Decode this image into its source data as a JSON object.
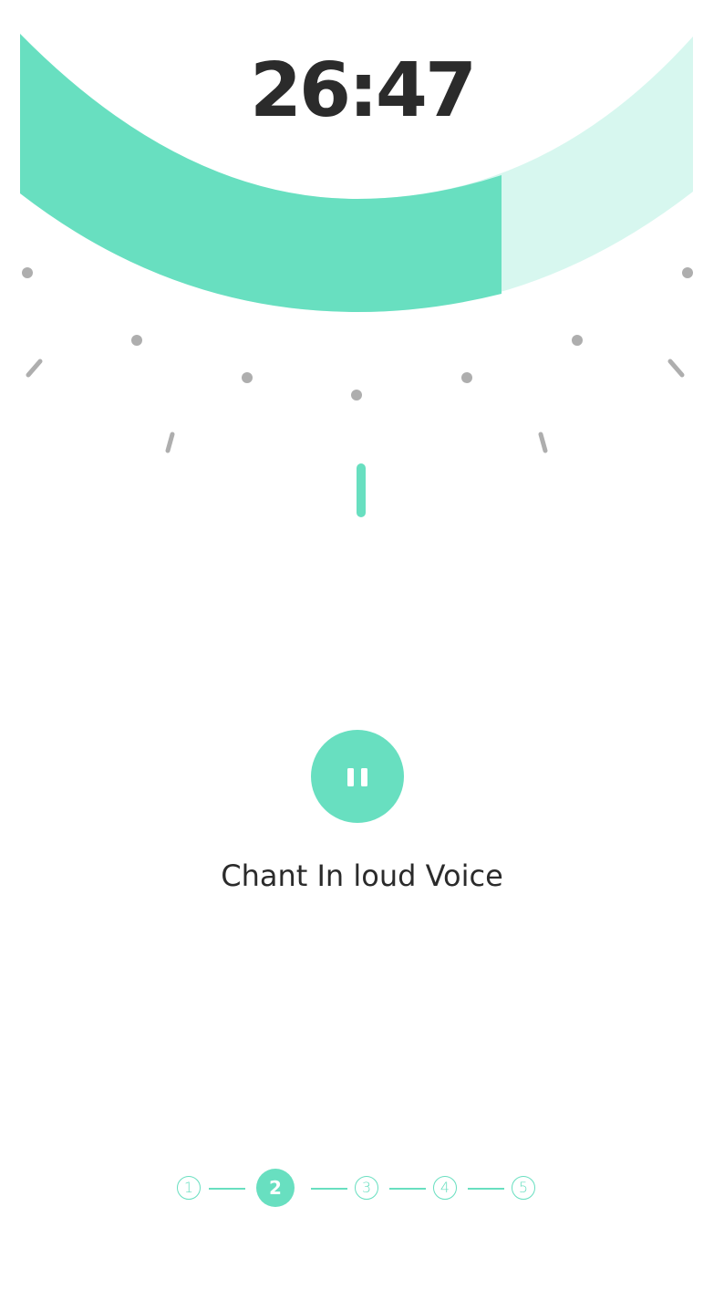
{
  "timer": {
    "time": "26:47",
    "progress": 0.68
  },
  "instruction": {
    "text": "Chant In loud Voice"
  },
  "pause_button": {
    "icon": "pause-icon",
    "state": "playing"
  },
  "stepper": {
    "steps": [
      {
        "label": "1",
        "active": false
      },
      {
        "label": "2",
        "active": true
      },
      {
        "label": "3",
        "active": false
      },
      {
        "label": "4",
        "active": false
      },
      {
        "label": "5",
        "active": false
      }
    ]
  },
  "colors": {
    "accent": "#68dfc0",
    "accent_light": "#d7f7ef",
    "text": "#2b2b2b",
    "tick": "#aeaeae"
  }
}
